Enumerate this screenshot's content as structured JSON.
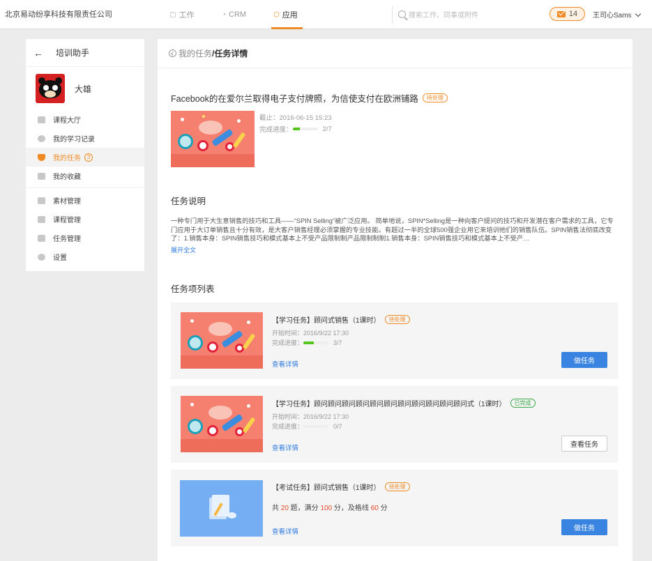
{
  "header": {
    "company": "北京易动纷享科技有限责任公司",
    "nav": [
      {
        "label": "工作",
        "icon": "work-icon"
      },
      {
        "label": "CRM",
        "icon": "crm-icon"
      },
      {
        "label": "应用",
        "icon": "app-icon",
        "active": true
      }
    ],
    "search_placeholder": "搜索工作、同事或附件",
    "message_count": "14",
    "user_name": "王司心Sams"
  },
  "sidebar": {
    "title": "培训助手",
    "profile_name": "大雄",
    "items": [
      {
        "label": "课程大厅",
        "icon": "list-icon"
      },
      {
        "label": "我的学习记录",
        "icon": "clock-icon"
      },
      {
        "label": "我的任务",
        "icon": "task-icon",
        "active": true,
        "count": "3"
      },
      {
        "label": "我的收藏",
        "icon": "folder-icon"
      },
      {
        "label": "素材管理",
        "icon": "material-icon"
      },
      {
        "label": "课程管理",
        "icon": "course-icon"
      },
      {
        "label": "任务管理",
        "icon": "task-manage-icon"
      },
      {
        "label": "设置",
        "icon": "gear-icon"
      }
    ]
  },
  "breadcrumb": {
    "parent": "我的任务",
    "separator": "/",
    "current": "任务详情"
  },
  "task": {
    "title": "Facebook的在爱尔兰取得电子支付牌照，为信使支付在欧洲铺路",
    "status": "待处理",
    "deadline_label": "截止：",
    "deadline": "2016-06-15 15:23",
    "progress_label": "完成进度：",
    "progress_text": "2/7",
    "progress": 0.2857
  },
  "description": {
    "heading": "任务说明",
    "text": "一种专门用于大生意销售的技巧和工具——“SPIN Selling”被广泛应用。 简单地说，SPIN*Selling是一种向客户提问的技巧和开发潜在客户需求的工具，它专门应用于大订单销售且十分有效，是大客户销售经理必须掌握的专业技能。有超过一半的全球500强企业用它来培训他们的销售队伍。SPIN销售法彻底改变了：1.销售本身：SPIN销售技巧和模式基本上不受产品限制制产品限制制制1.销售本身：SPIN销售技巧和模式基本上不受产…",
    "expand": "展开全文"
  },
  "task_list": {
    "heading": "任务项列表",
    "detail_link": "查看详情",
    "items": [
      {
        "title": "【学习任务】顾问式销售（1课时）",
        "status": "待处理",
        "start_label": "开始时间：",
        "start": "2016/9/22  17:30",
        "progress_label": "完成进度：",
        "progress_text": "3/7",
        "progress": 0.4286,
        "button": "做任务"
      },
      {
        "title": "【学习任务】顾问顾问顾问顾问顾问顾问顾问顾问顾问顾问顾问式（1课时）",
        "status": "已完成",
        "start_label": "开始时间：",
        "start": "2016/9/22  17:30",
        "progress_label": "完成进度：",
        "progress_text": "0/7",
        "progress": 0,
        "button": "查看任务"
      },
      {
        "title": "【考试任务】顾问式销售（1课时）",
        "status": "待处理",
        "score_parts": [
          "共 ",
          "20",
          " 题，满分 ",
          "100",
          " 分，及格线 ",
          "60",
          " 分"
        ],
        "button": "做任务"
      }
    ]
  },
  "colors": {
    "accent": "#f08a24",
    "primary_button": "#3884e0",
    "link": "#2d7be0",
    "done": "#3aa845",
    "progress": "#52c41a"
  }
}
